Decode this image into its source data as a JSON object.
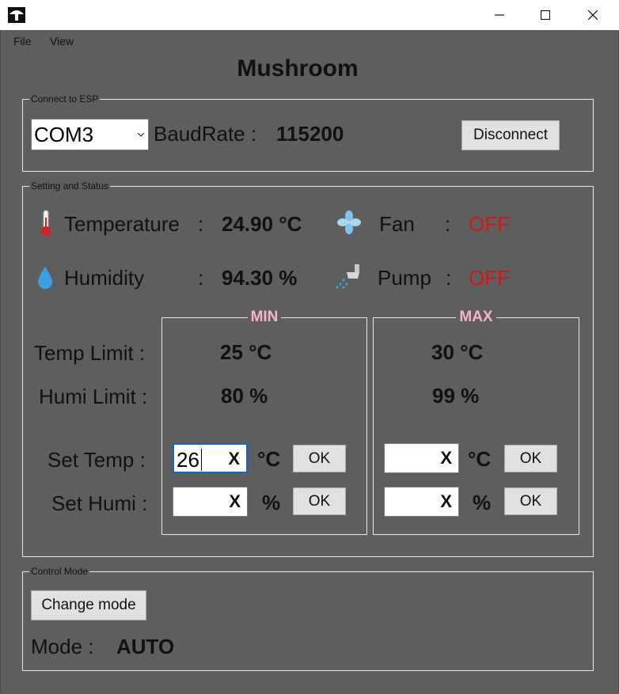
{
  "window": {
    "minimize_icon": "minimize-icon",
    "maximize_icon": "maximize-icon",
    "close_icon": "close-icon"
  },
  "menu": {
    "file": "File",
    "view": "View"
  },
  "app_title": "Mushroom",
  "connect": {
    "legend": "Connect to ESP",
    "port": "COM3",
    "baud_label": "BaudRate :",
    "baud_value": "115200",
    "disconnect": "Disconnect"
  },
  "status": {
    "legend": "Setting and Status",
    "temp_label": "Temperature",
    "temp_sep": ":",
    "temp_value": "24.90 °C",
    "fan_label": "Fan",
    "fan_sep": ":",
    "fan_value": "OFF",
    "humi_label": "Humidity",
    "humi_sep": ":",
    "humi_value": "94.30  %",
    "pump_label": "Pump",
    "pump_sep": ":",
    "pump_value": "OFF",
    "status_off_color": "#cc1a1a"
  },
  "limits": {
    "temp_limit_label": "Temp Limit :",
    "humi_limit_label": "Humi Limit :",
    "set_temp_label": "Set Temp :",
    "set_humi_label": "Set Humi :",
    "min": {
      "legend": "MIN",
      "temp": "25 °C",
      "humi": "80  %",
      "set_temp_value": "26",
      "set_humi_value": "",
      "clear": "X",
      "temp_unit": "°C",
      "humi_unit": "%",
      "ok": "OK"
    },
    "max": {
      "legend": "MAX",
      "temp": "30 °C",
      "humi": "99  %",
      "set_temp_value": "",
      "set_humi_value": "",
      "clear": "X",
      "temp_unit": "°C",
      "humi_unit": "%",
      "ok": "OK"
    },
    "legend_color": "#f5b5c5"
  },
  "control": {
    "legend": "Control Mode",
    "change_mode": "Change mode",
    "mode_label": "Mode  :",
    "mode_value": "AUTO"
  },
  "icons": {
    "app": "mushroom-icon",
    "temperature": "thermometer-icon",
    "humidity": "water-drop-icon",
    "fan": "fan-icon",
    "pump": "sprinkler-icon",
    "combo": "chevron-down-icon"
  }
}
